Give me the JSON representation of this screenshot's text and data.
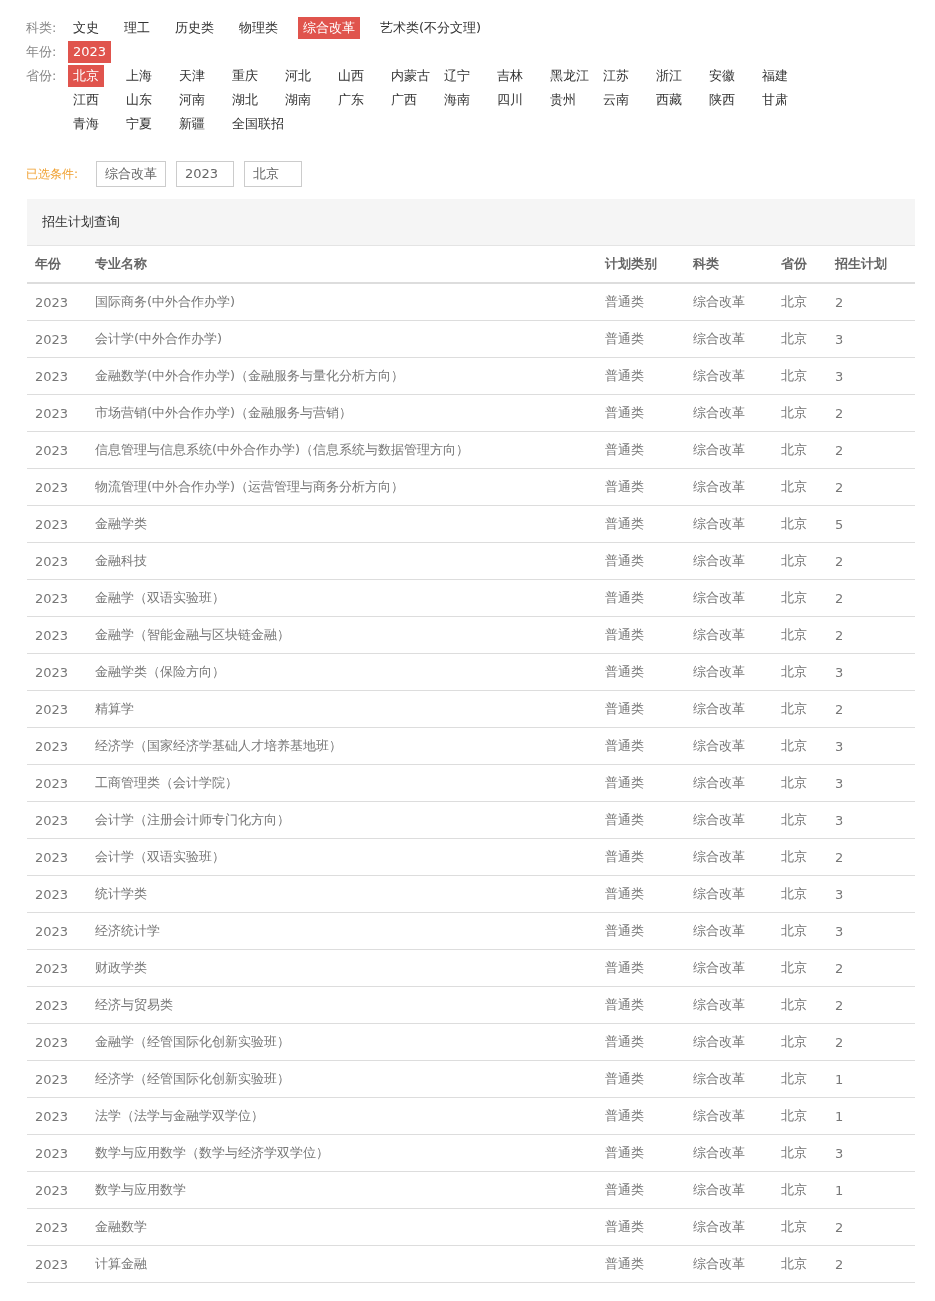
{
  "filters": [
    {
      "label": "科类:",
      "kind": "inline",
      "options": [
        {
          "text": "文史",
          "selected": false
        },
        {
          "text": "理工",
          "selected": false
        },
        {
          "text": "历史类",
          "selected": false
        },
        {
          "text": "物理类",
          "selected": false
        },
        {
          "text": "综合改革",
          "selected": true
        },
        {
          "text": "艺术类(不分文理)",
          "selected": false
        }
      ]
    },
    {
      "label": "年份:",
      "kind": "inline",
      "options": [
        {
          "text": "2023",
          "selected": true
        }
      ]
    },
    {
      "label": "省份:",
      "kind": "grid",
      "options": [
        {
          "text": "北京",
          "selected": true
        },
        {
          "text": "上海",
          "selected": false
        },
        {
          "text": "天津",
          "selected": false
        },
        {
          "text": "重庆",
          "selected": false
        },
        {
          "text": "河北",
          "selected": false
        },
        {
          "text": "山西",
          "selected": false
        },
        {
          "text": "内蒙古",
          "selected": false
        },
        {
          "text": "辽宁",
          "selected": false
        },
        {
          "text": "吉林",
          "selected": false
        },
        {
          "text": "黑龙江",
          "selected": false
        },
        {
          "text": "江苏",
          "selected": false
        },
        {
          "text": "浙江",
          "selected": false
        },
        {
          "text": "安徽",
          "selected": false
        },
        {
          "text": "福建",
          "selected": false
        },
        {
          "text": "江西",
          "selected": false
        },
        {
          "text": "山东",
          "selected": false
        },
        {
          "text": "河南",
          "selected": false
        },
        {
          "text": "湖北",
          "selected": false
        },
        {
          "text": "湖南",
          "selected": false
        },
        {
          "text": "广东",
          "selected": false
        },
        {
          "text": "广西",
          "selected": false
        },
        {
          "text": "海南",
          "selected": false
        },
        {
          "text": "四川",
          "selected": false
        },
        {
          "text": "贵州",
          "selected": false
        },
        {
          "text": "云南",
          "selected": false
        },
        {
          "text": "西藏",
          "selected": false
        },
        {
          "text": "陕西",
          "selected": false
        },
        {
          "text": "甘肃",
          "selected": false
        },
        {
          "text": "青海",
          "selected": false
        },
        {
          "text": "宁夏",
          "selected": false
        },
        {
          "text": "新疆",
          "selected": false
        },
        {
          "text": "全国联招",
          "selected": false
        }
      ]
    }
  ],
  "selected_conditions": {
    "label": "已选条件:",
    "tags": [
      "综合改革",
      "2023",
      "北京"
    ]
  },
  "panel": {
    "title": "招生计划查询",
    "table": {
      "columns": [
        "年份",
        "专业名称",
        "计划类别",
        "科类",
        "省份",
        "招生计划"
      ],
      "rows": [
        [
          "2023",
          "国际商务(中外合作办学)",
          "普通类",
          "综合改革",
          "北京",
          "2"
        ],
        [
          "2023",
          "会计学(中外合作办学)",
          "普通类",
          "综合改革",
          "北京",
          "3"
        ],
        [
          "2023",
          "金融数学(中外合作办学)（金融服务与量化分析方向）",
          "普通类",
          "综合改革",
          "北京",
          "3"
        ],
        [
          "2023",
          "市场营销(中外合作办学)（金融服务与营销）",
          "普通类",
          "综合改革",
          "北京",
          "2"
        ],
        [
          "2023",
          "信息管理与信息系统(中外合作办学)（信息系统与数据管理方向）",
          "普通类",
          "综合改革",
          "北京",
          "2"
        ],
        [
          "2023",
          "物流管理(中外合作办学)（运营管理与商务分析方向）",
          "普通类",
          "综合改革",
          "北京",
          "2"
        ],
        [
          "2023",
          "金融学类",
          "普通类",
          "综合改革",
          "北京",
          "5"
        ],
        [
          "2023",
          "金融科技",
          "普通类",
          "综合改革",
          "北京",
          "2"
        ],
        [
          "2023",
          "金融学（双语实验班）",
          "普通类",
          "综合改革",
          "北京",
          "2"
        ],
        [
          "2023",
          "金融学（智能金融与区块链金融）",
          "普通类",
          "综合改革",
          "北京",
          "2"
        ],
        [
          "2023",
          "金融学类（保险方向）",
          "普通类",
          "综合改革",
          "北京",
          "3"
        ],
        [
          "2023",
          "精算学",
          "普通类",
          "综合改革",
          "北京",
          "2"
        ],
        [
          "2023",
          "经济学（国家经济学基础人才培养基地班）",
          "普通类",
          "综合改革",
          "北京",
          "3"
        ],
        [
          "2023",
          "工商管理类（会计学院）",
          "普通类",
          "综合改革",
          "北京",
          "3"
        ],
        [
          "2023",
          "会计学（注册会计师专门化方向）",
          "普通类",
          "综合改革",
          "北京",
          "3"
        ],
        [
          "2023",
          "会计学（双语实验班）",
          "普通类",
          "综合改革",
          "北京",
          "2"
        ],
        [
          "2023",
          "统计学类",
          "普通类",
          "综合改革",
          "北京",
          "3"
        ],
        [
          "2023",
          "经济统计学",
          "普通类",
          "综合改革",
          "北京",
          "3"
        ],
        [
          "2023",
          "财政学类",
          "普通类",
          "综合改革",
          "北京",
          "2"
        ],
        [
          "2023",
          "经济与贸易类",
          "普通类",
          "综合改革",
          "北京",
          "2"
        ],
        [
          "2023",
          "金融学（经管国际化创新实验班）",
          "普通类",
          "综合改革",
          "北京",
          "2"
        ],
        [
          "2023",
          "经济学（经管国际化创新实验班）",
          "普通类",
          "综合改革",
          "北京",
          "1"
        ],
        [
          "2023",
          "法学（法学与金融学双学位）",
          "普通类",
          "综合改革",
          "北京",
          "1"
        ],
        [
          "2023",
          "数学与应用数学（数学与经济学双学位）",
          "普通类",
          "综合改革",
          "北京",
          "3"
        ],
        [
          "2023",
          "数学与应用数学",
          "普通类",
          "综合改革",
          "北京",
          "1"
        ],
        [
          "2023",
          "金融数学",
          "普通类",
          "综合改革",
          "北京",
          "2"
        ],
        [
          "2023",
          "计算金融",
          "普通类",
          "综合改革",
          "北京",
          "2"
        ]
      ]
    }
  }
}
